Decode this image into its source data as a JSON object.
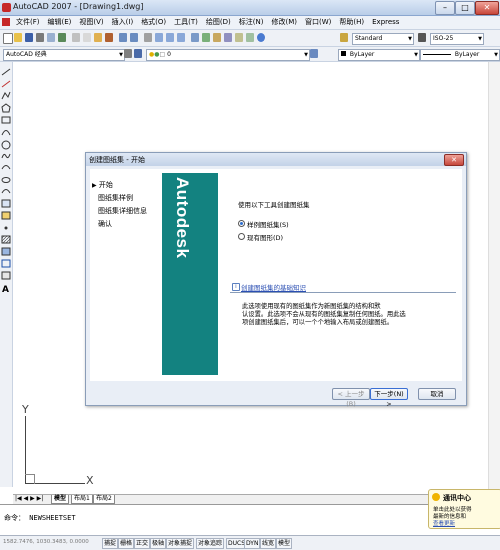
{
  "window": {
    "title": "AutoCAD 2007 - [Drawing1.dwg]"
  },
  "menu": [
    "文件(F)",
    "编辑(E)",
    "视图(V)",
    "插入(I)",
    "格式(O)",
    "工具(T)",
    "绘图(D)",
    "标注(N)",
    "修改(M)",
    "窗口(W)",
    "帮助(H)",
    "Express"
  ],
  "toolbar": {
    "workspace": "AutoCAD 经典",
    "text_style": "Standard",
    "dim_style": "ISO-25",
    "layer": "0",
    "color": "ByLayer",
    "linetype": "ByLayer"
  },
  "ucs": {
    "x_label": "X",
    "y_label": "Y"
  },
  "dialog": {
    "title": "创建图纸集 - 开始",
    "steps": [
      {
        "label": "开始",
        "active": true
      },
      {
        "label": "图纸集样例",
        "active": false
      },
      {
        "label": "图纸集详细信息",
        "active": false
      },
      {
        "label": "确认",
        "active": false
      }
    ],
    "banner_text": "Autodesk",
    "prompt": "使用以下工具创建图纸集",
    "options": [
      {
        "label": "样例图纸集(S)",
        "selected": true
      },
      {
        "label": "现有图形(D)",
        "selected": false
      }
    ],
    "info_link": "创建图纸集的基础知识",
    "description": [
      "此选项使用现有的图纸集作为新图纸集的结构和默",
      "认设置。此选项不会从现有的图纸集复制任何图纸。用此选",
      "项创建图纸集后，可以一个个地输入布局或创建图纸。"
    ],
    "buttons": {
      "back": "< 上一步(B)",
      "next": "下一步(N) >",
      "cancel": "取消"
    }
  },
  "tabs": {
    "nav": "|◀ ◀ ▶ ▶|",
    "model": "模型",
    "layout1": "布局1",
    "layout2": "布局2"
  },
  "command": {
    "prompt": "命令：",
    "text": "NEWSHEETSET"
  },
  "notification": {
    "title": "通讯中心",
    "line1": "单击此处以获得",
    "line2": "最新的信息和",
    "link": "查看更新"
  },
  "status": {
    "coords": "1582.7476, 1030.3483, 0.0000",
    "buttons": [
      "捕捉",
      "栅格",
      "正交",
      "极轴",
      "对象捕捉",
      "对象追踪",
      "DUCS",
      "DYN",
      "线宽",
      "模型"
    ]
  },
  "colors": {
    "banner": "#138280",
    "titlebar": "#c3d2e8",
    "close": "#c6483c"
  }
}
